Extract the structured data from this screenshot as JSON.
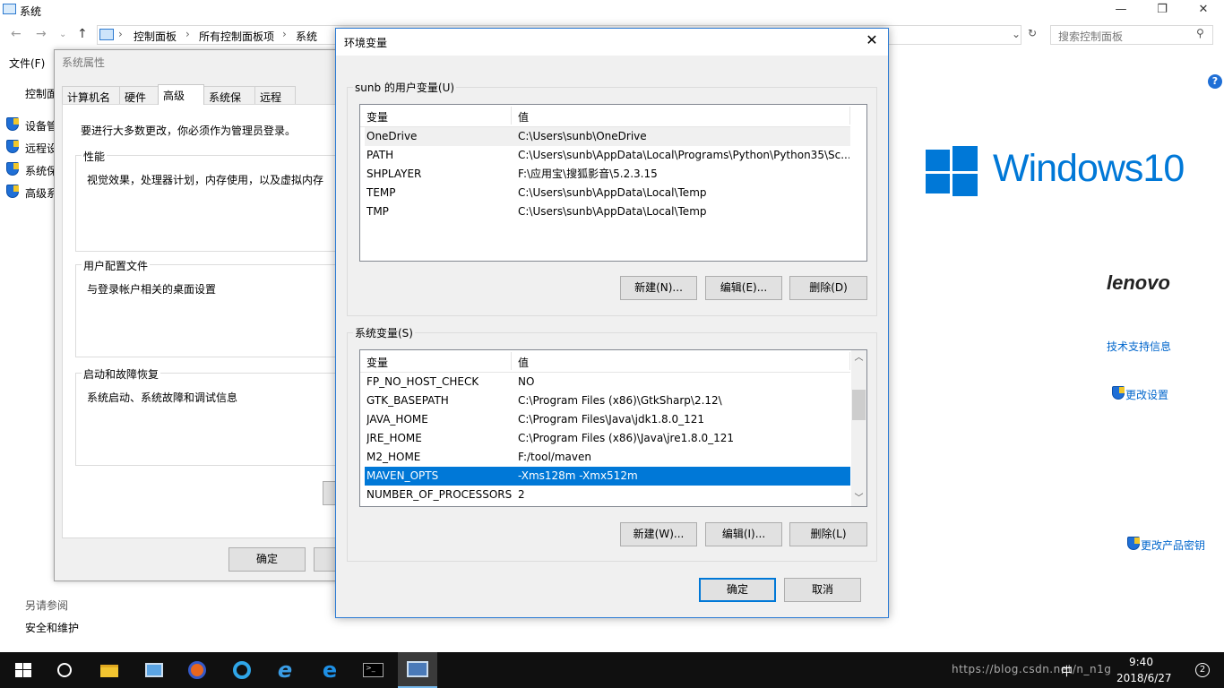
{
  "control_panel": {
    "window_title": "系统",
    "breadcrumb": [
      "控制面板",
      "所有控制面板项",
      "系统"
    ],
    "search_placeholder": "搜索控制面板",
    "menu_file": "文件(F)",
    "side_header": "控制面",
    "side_items": [
      "设备管",
      "远程设",
      "系统保",
      "高级系"
    ],
    "see_also_title": "另请参阅",
    "see_also_item": "安全和维护",
    "right_links": {
      "support": "技术支持信息",
      "change_settings": "更改设置",
      "change_key": "更改产品密钥"
    },
    "windows_brand": "Windows10",
    "oem_brand": "lenovo"
  },
  "system_properties": {
    "title": "系统属性",
    "tabs": [
      "计算机名",
      "硬件",
      "高级",
      "系统保护",
      "远程"
    ],
    "active_tab": "高级",
    "admin_note": "要进行大多数更改，你必须作为管理员登录。",
    "groups": [
      {
        "label": "性能",
        "desc": "视觉效果，处理器计划，内存使用，以及虚拟内存"
      },
      {
        "label": "用户配置文件",
        "desc": "与登录帐户相关的桌面设置"
      },
      {
        "label": "启动和故障恢复",
        "desc": "系统启动、系统故障和调试信息"
      }
    ],
    "ok_label": "确定"
  },
  "env_dialog": {
    "title": "环境变量",
    "close_glyph": "✕",
    "user_section": {
      "label": "sunb 的用户变量(U)",
      "col_var": "变量",
      "col_val": "值",
      "rows": [
        {
          "name": "OneDrive",
          "value": "C:\\Users\\sunb\\OneDrive"
        },
        {
          "name": "PATH",
          "value": "C:\\Users\\sunb\\AppData\\Local\\Programs\\Python\\Python35\\Sc..."
        },
        {
          "name": "SHPLAYER",
          "value": "F:\\应用宝\\搜狐影音\\5.2.3.15"
        },
        {
          "name": "TEMP",
          "value": "C:\\Users\\sunb\\AppData\\Local\\Temp"
        },
        {
          "name": "TMP",
          "value": "C:\\Users\\sunb\\AppData\\Local\\Temp"
        }
      ],
      "new_label": "新建(N)...",
      "edit_label": "编辑(E)...",
      "delete_label": "删除(D)"
    },
    "system_section": {
      "label": "系统变量(S)",
      "col_var": "变量",
      "col_val": "值",
      "rows": [
        {
          "name": "FP_NO_HOST_CHECK",
          "value": "NO"
        },
        {
          "name": "GTK_BASEPATH",
          "value": "C:\\Program Files (x86)\\GtkSharp\\2.12\\"
        },
        {
          "name": "JAVA_HOME",
          "value": "C:\\Program Files\\Java\\jdk1.8.0_121"
        },
        {
          "name": "JRE_HOME",
          "value": "C:\\Program Files (x86)\\Java\\jre1.8.0_121"
        },
        {
          "name": "M2_HOME",
          "value": "F:/tool/maven"
        },
        {
          "name": "MAVEN_OPTS",
          "value": "-Xms128m -Xmx512m"
        },
        {
          "name": "NUMBER_OF_PROCESSORS",
          "value": "2"
        }
      ],
      "selected": "MAVEN_OPTS",
      "new_label": "新建(W)...",
      "edit_label": "编辑(I)...",
      "delete_label": "删除(L)"
    },
    "ok_label": "确定",
    "cancel_label": "取消"
  },
  "taskbar": {
    "time": "9:40",
    "date": "2018/6/27",
    "ime": "中",
    "watermark": "https://blog.csdn.net/n_n1g",
    "notification_count": "2"
  },
  "colors": {
    "accent": "#0078d7",
    "selection": "#0078d7",
    "taskbar": "#101010"
  }
}
